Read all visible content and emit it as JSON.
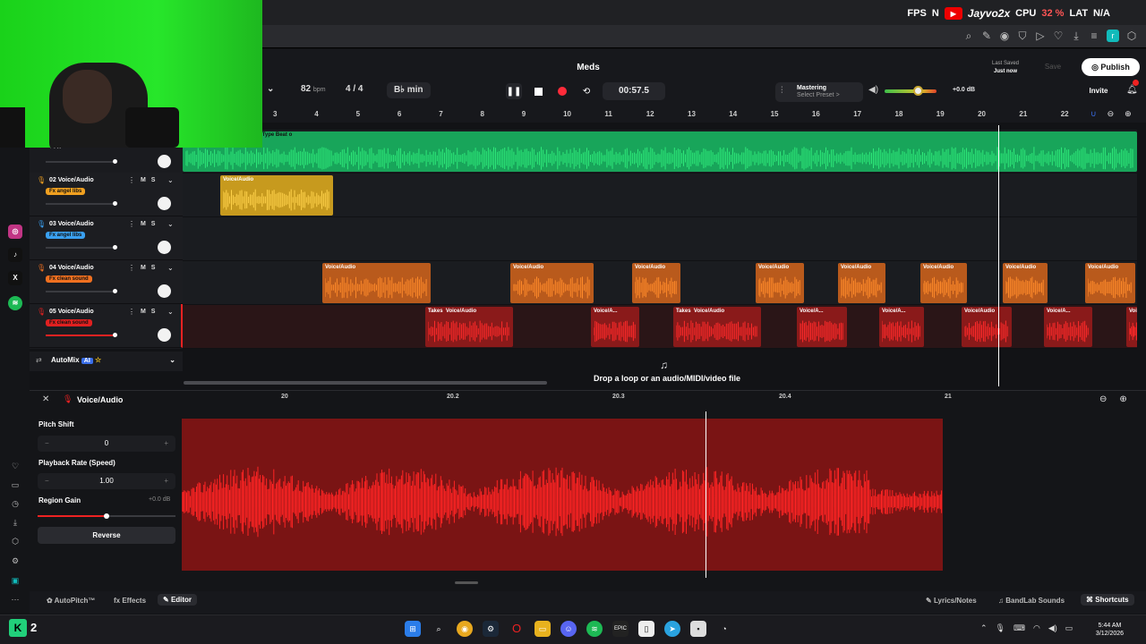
{
  "overlay": {
    "fps": "FPS",
    "n": "N",
    "channel": "Jayvo2x",
    "cpu_label": "CPU",
    "cpu_value": "32 %",
    "lat_label": "LAT",
    "lat_value": "N/A"
  },
  "header": {
    "project_title": "Meds",
    "bpm": "82",
    "bpm_unit": "bpm",
    "time_signature": "4 / 4",
    "key": "B♭ min",
    "time_display": "00:57.5",
    "mastering_title": "Mastering",
    "mastering_sub": "Select Preset >",
    "master_volume": "+0.0 dB",
    "master_volume_level": 0.6,
    "last_saved_label": "Last Saved",
    "last_saved_value": "Just now",
    "save_label": "Save",
    "publish_label": "Publish",
    "invite_label": "Invite"
  },
  "ruler": [
    "3",
    "4",
    "5",
    "6",
    "7",
    "8",
    "9",
    "10",
    "11",
    "12",
    "13",
    "14",
    "15",
    "16",
    "17",
    "18",
    "19",
    "20",
    "21",
    "22"
  ],
  "top_clip_label": "..d Type Beat o",
  "tracks": [
    {
      "name": "02 Voice/Audio",
      "fx": "Fx angel libs",
      "fx_color": "#f0a020",
      "clip_color": "#c79a1e",
      "wave_color": "#ffd24a"
    },
    {
      "name": "03 Voice/Audio",
      "fx": "Fx angel libs",
      "fx_color": "#3aa0f0",
      "clip_color": "#1a1c20",
      "wave_color": "#3aa0f0"
    },
    {
      "name": "04 Voice/Audio",
      "fx": "Fx clean sound",
      "fx_color": "#f07020",
      "clip_color": "#b95a1c",
      "wave_color": "#ff8a2a"
    },
    {
      "name": "05 Voice/Audio",
      "fx": "Fx clean sound",
      "fx_color": "#e02020",
      "clip_color": "#8a1a1a",
      "wave_color": "#ff2a2a"
    }
  ],
  "track_buttons": {
    "mute": "M",
    "solo": "S"
  },
  "track_top_label": "+ FX",
  "clip_label": "Voice/Audio",
  "clip_label_short": "Voice/A...",
  "takes_label": "Takes",
  "automix_label": "AutoMix",
  "automix_badge": "AI",
  "drop_zone_text": "Drop a loop or an audio/MIDI/video file",
  "editor": {
    "title": "Voice/Audio",
    "pitch_label": "Pitch Shift",
    "pitch_value": "0",
    "rate_label": "Playback Rate (Speed)",
    "rate_value": "1.00",
    "gain_label": "Region Gain",
    "gain_value": "+0.0 dB",
    "reverse_label": "Reverse",
    "ruler": [
      "20",
      "20.2",
      "20.3",
      "20.4",
      "21"
    ],
    "minus": "−",
    "plus": "+"
  },
  "bottom_bar": {
    "autopitch": "AutoPitch™",
    "effects": "Effects",
    "editor": "Editor",
    "lyrics": "Lyrics/Notes",
    "bandlab": "BandLab Sounds",
    "shortcuts": "Shortcuts"
  },
  "taskbar": {
    "k_num": "2",
    "time": "5:44 AM",
    "date": "3/12/2026"
  },
  "colors": {
    "accent_green": "#22c55e",
    "red_track": "#e02020",
    "orange_track": "#f07020"
  }
}
